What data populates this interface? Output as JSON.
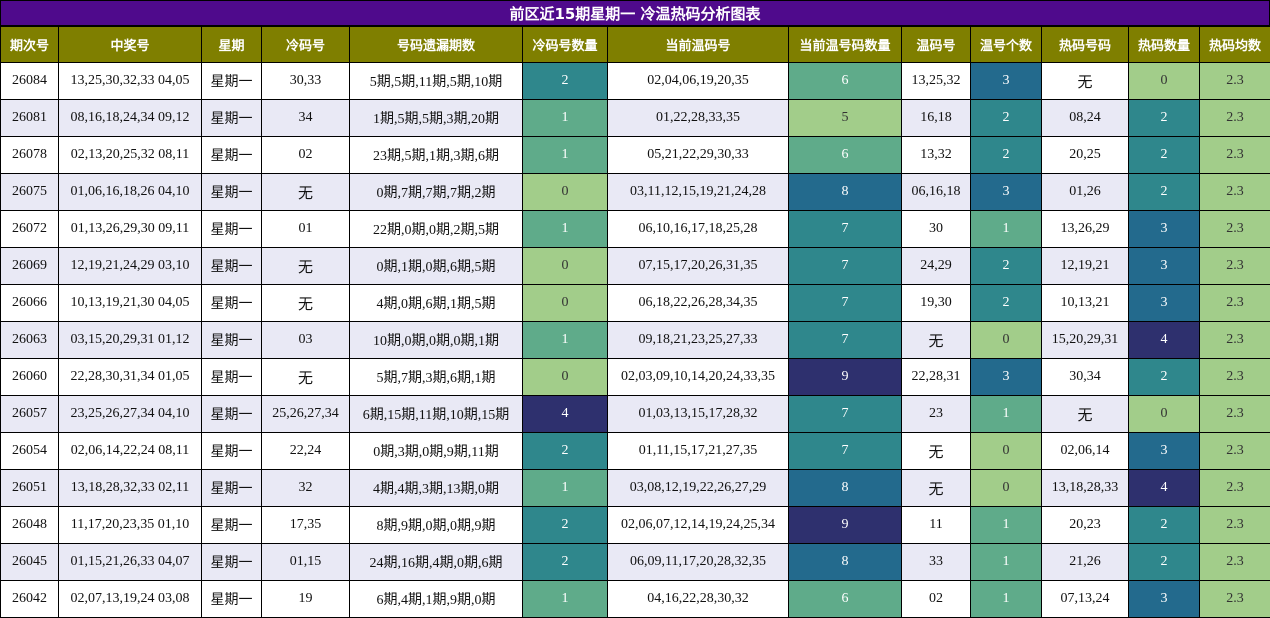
{
  "title": "前区近15期星期一 冷温热码分析图表",
  "columns": [
    "期次号",
    "中奖号",
    "星期",
    "冷码号",
    "号码遗漏期数",
    "冷码号数量",
    "当前温码号",
    "当前温号码数量",
    "温码号",
    "温号个数",
    "热码号码",
    "热码数量",
    "热码均数"
  ],
  "colors": {
    "title_bg": "#4f0a8c",
    "header_bg": "#7f7f00",
    "row_alt": "#e9e9f5",
    "heat_0": "#a2cd8a",
    "heat_1": "#5fab8a",
    "heat_2": "#2f878c",
    "heat_3": "#236a8d",
    "heat_4": "#2e306e",
    "avg": "#a2cd8a"
  },
  "chart_data": {
    "type": "table",
    "rows": [
      {
        "issue": "26084",
        "draw": "13,25,30,32,33 04,05",
        "weekday": "星期一",
        "cold": "30,33",
        "miss": "5期,5期,11期,5期,10期",
        "cold_count": 2,
        "warm_cur": "02,04,06,19,20,35",
        "warm_cur_count": 6,
        "warm": "13,25,32",
        "warm_count": 3,
        "hot": "无",
        "hot_count": 0,
        "hot_avg": "2.3"
      },
      {
        "issue": "26081",
        "draw": "08,16,18,24,34 09,12",
        "weekday": "星期一",
        "cold": "34",
        "miss": "1期,5期,5期,3期,20期",
        "cold_count": 1,
        "warm_cur": "01,22,28,33,35",
        "warm_cur_count": 5,
        "warm": "16,18",
        "warm_count": 2,
        "hot": "08,24",
        "hot_count": 2,
        "hot_avg": "2.3"
      },
      {
        "issue": "26078",
        "draw": "02,13,20,25,32 08,11",
        "weekday": "星期一",
        "cold": "02",
        "miss": "23期,5期,1期,3期,6期",
        "cold_count": 1,
        "warm_cur": "05,21,22,29,30,33",
        "warm_cur_count": 6,
        "warm": "13,32",
        "warm_count": 2,
        "hot": "20,25",
        "hot_count": 2,
        "hot_avg": "2.3"
      },
      {
        "issue": "26075",
        "draw": "01,06,16,18,26 04,10",
        "weekday": "星期一",
        "cold": "无",
        "miss": "0期,7期,7期,7期,2期",
        "cold_count": 0,
        "warm_cur": "03,11,12,15,19,21,24,28",
        "warm_cur_count": 8,
        "warm": "06,16,18",
        "warm_count": 3,
        "hot": "01,26",
        "hot_count": 2,
        "hot_avg": "2.3"
      },
      {
        "issue": "26072",
        "draw": "01,13,26,29,30 09,11",
        "weekday": "星期一",
        "cold": "01",
        "miss": "22期,0期,0期,2期,5期",
        "cold_count": 1,
        "warm_cur": "06,10,16,17,18,25,28",
        "warm_cur_count": 7,
        "warm": "30",
        "warm_count": 1,
        "hot": "13,26,29",
        "hot_count": 3,
        "hot_avg": "2.3"
      },
      {
        "issue": "26069",
        "draw": "12,19,21,24,29 03,10",
        "weekday": "星期一",
        "cold": "无",
        "miss": "0期,1期,0期,6期,5期",
        "cold_count": 0,
        "warm_cur": "07,15,17,20,26,31,35",
        "warm_cur_count": 7,
        "warm": "24,29",
        "warm_count": 2,
        "hot": "12,19,21",
        "hot_count": 3,
        "hot_avg": "2.3"
      },
      {
        "issue": "26066",
        "draw": "10,13,19,21,30 04,05",
        "weekday": "星期一",
        "cold": "无",
        "miss": "4期,0期,6期,1期,5期",
        "cold_count": 0,
        "warm_cur": "06,18,22,26,28,34,35",
        "warm_cur_count": 7,
        "warm": "19,30",
        "warm_count": 2,
        "hot": "10,13,21",
        "hot_count": 3,
        "hot_avg": "2.3"
      },
      {
        "issue": "26063",
        "draw": "03,15,20,29,31 01,12",
        "weekday": "星期一",
        "cold": "03",
        "miss": "10期,0期,0期,0期,1期",
        "cold_count": 1,
        "warm_cur": "09,18,21,23,25,27,33",
        "warm_cur_count": 7,
        "warm": "无",
        "warm_count": 0,
        "hot": "15,20,29,31",
        "hot_count": 4,
        "hot_avg": "2.3"
      },
      {
        "issue": "26060",
        "draw": "22,28,30,31,34 01,05",
        "weekday": "星期一",
        "cold": "无",
        "miss": "5期,7期,3期,6期,1期",
        "cold_count": 0,
        "warm_cur": "02,03,09,10,14,20,24,33,35",
        "warm_cur_count": 9,
        "warm": "22,28,31",
        "warm_count": 3,
        "hot": "30,34",
        "hot_count": 2,
        "hot_avg": "2.3"
      },
      {
        "issue": "26057",
        "draw": "23,25,26,27,34 04,10",
        "weekday": "星期一",
        "cold": "25,26,27,34",
        "miss": "6期,15期,11期,10期,15期",
        "cold_count": 4,
        "warm_cur": "01,03,13,15,17,28,32",
        "warm_cur_count": 7,
        "warm": "23",
        "warm_count": 1,
        "hot": "无",
        "hot_count": 0,
        "hot_avg": "2.3"
      },
      {
        "issue": "26054",
        "draw": "02,06,14,22,24 08,11",
        "weekday": "星期一",
        "cold": "22,24",
        "miss": "0期,3期,0期,9期,11期",
        "cold_count": 2,
        "warm_cur": "01,11,15,17,21,27,35",
        "warm_cur_count": 7,
        "warm": "无",
        "warm_count": 0,
        "hot": "02,06,14",
        "hot_count": 3,
        "hot_avg": "2.3"
      },
      {
        "issue": "26051",
        "draw": "13,18,28,32,33 02,11",
        "weekday": "星期一",
        "cold": "32",
        "miss": "4期,4期,3期,13期,0期",
        "cold_count": 1,
        "warm_cur": "03,08,12,19,22,26,27,29",
        "warm_cur_count": 8,
        "warm": "无",
        "warm_count": 0,
        "hot": "13,18,28,33",
        "hot_count": 4,
        "hot_avg": "2.3"
      },
      {
        "issue": "26048",
        "draw": "11,17,20,23,35 01,10",
        "weekday": "星期一",
        "cold": "17,35",
        "miss": "8期,9期,0期,0期,9期",
        "cold_count": 2,
        "warm_cur": "02,06,07,12,14,19,24,25,34",
        "warm_cur_count": 9,
        "warm": "11",
        "warm_count": 1,
        "hot": "20,23",
        "hot_count": 2,
        "hot_avg": "2.3"
      },
      {
        "issue": "26045",
        "draw": "01,15,21,26,33 04,07",
        "weekday": "星期一",
        "cold": "01,15",
        "miss": "24期,16期,4期,0期,6期",
        "cold_count": 2,
        "warm_cur": "06,09,11,17,20,28,32,35",
        "warm_cur_count": 8,
        "warm": "33",
        "warm_count": 1,
        "hot": "21,26",
        "hot_count": 2,
        "hot_avg": "2.3"
      },
      {
        "issue": "26042",
        "draw": "02,07,13,19,24 03,08",
        "weekday": "星期一",
        "cold": "19",
        "miss": "6期,4期,1期,9期,0期",
        "cold_count": 1,
        "warm_cur": "04,16,22,28,30,32",
        "warm_cur_count": 6,
        "warm": "02",
        "warm_count": 1,
        "hot": "07,13,24",
        "hot_count": 3,
        "hot_avg": "2.3"
      }
    ]
  }
}
